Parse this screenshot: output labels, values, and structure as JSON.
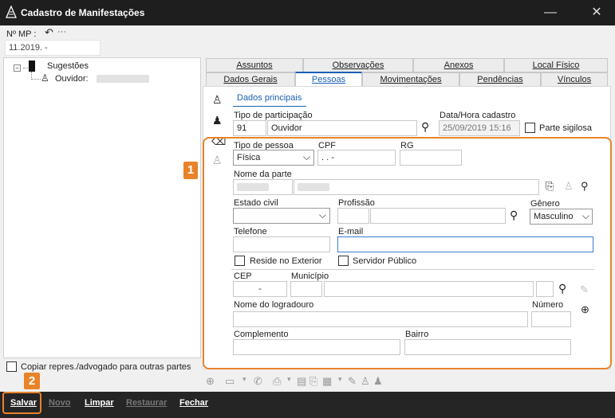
{
  "window": {
    "title": "Cadastro de Manifestações",
    "minimize_icon": "minimize-icon",
    "close_icon": "close-icon"
  },
  "top": {
    "nmp_label": "Nº MP :",
    "nmp_value": "11.2019.    -"
  },
  "tree": {
    "root": "Sugestões",
    "child": "Ouvidor:"
  },
  "tabs_row1": [
    "Assuntos",
    "Observações",
    "Anexos",
    "Local Físico"
  ],
  "tabs_row2": [
    "Dados Gerais",
    "Pessoas",
    "Movimentações",
    "Pendências",
    "Vínculos"
  ],
  "active_tab": "Pessoas",
  "subtab": "Dados principais",
  "form": {
    "tipo_participacao_label": "Tipo de participação",
    "tipo_participacao_code": "91",
    "tipo_participacao_value": "Ouvidor",
    "data_hora_label": "Data/Hora cadastro",
    "data_hora_value": "25/09/2019 15:16",
    "parte_sigilosa_label": "Parte sigilosa",
    "tipo_pessoa_label": "Tipo de pessoa",
    "tipo_pessoa_value": "Física",
    "cpf_label": "CPF",
    "cpf_value": ".   .   -",
    "rg_label": "RG",
    "nome_label": "Nome da parte",
    "estado_civil_label": "Estado civil",
    "profissao_label": "Profissão",
    "genero_label": "Gênero",
    "genero_value": "Masculino",
    "telefone_label": "Telefone",
    "email_label": "E-mail",
    "reside_exterior_label": "Reside no Exterior",
    "servidor_publico_label": "Servidor Público",
    "cep_label": "CEP",
    "cep_value": "-",
    "municipio_label": "Município",
    "logradouro_label": "Nome do logradouro",
    "numero_label": "Número",
    "complemento_label": "Complemento",
    "bairro_label": "Bairro"
  },
  "copiar_label": "Copiar repres./advogado para outras partes",
  "badges": {
    "one": "1",
    "two": "2"
  },
  "footer": {
    "salvar": "Salvar",
    "novo": "Novo",
    "limpar": "Limpar",
    "restaurar": "Restaurar",
    "fechar": "Fechar"
  },
  "colors": {
    "highlight": "#e8832a",
    "accent": "#1a5fb4",
    "titlebar": "#1e1e1e"
  }
}
